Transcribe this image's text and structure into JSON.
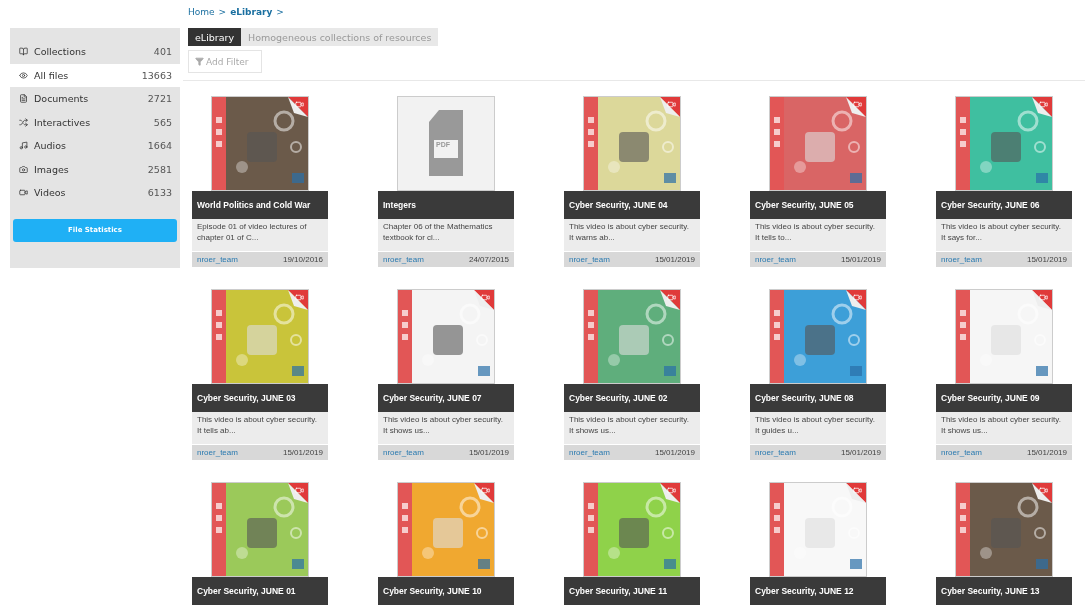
{
  "breadcrumb": [
    {
      "label": "Home",
      "current": false,
      "separator": ">"
    },
    {
      "label": "eLibrary",
      "current": true,
      "separator": ">"
    }
  ],
  "sidebar": {
    "items": [
      {
        "kind": "collections",
        "label": "Collections",
        "count": "401",
        "selected": false
      },
      {
        "kind": "all",
        "label": "All files",
        "count": "13663",
        "selected": true
      },
      {
        "kind": "documents",
        "label": "Documents",
        "count": "2721",
        "selected": false
      },
      {
        "kind": "interactives",
        "label": "Interactives",
        "count": "565",
        "selected": false
      },
      {
        "kind": "audios",
        "label": "Audios",
        "count": "1664",
        "selected": false
      },
      {
        "kind": "images",
        "label": "Images",
        "count": "2581",
        "selected": false
      },
      {
        "kind": "videos",
        "label": "Videos",
        "count": "6133",
        "selected": false
      }
    ],
    "button": "File Statistics"
  },
  "header": {
    "title": "eLibrary",
    "subtitle": "Homogeneous collections of resources",
    "filter_button": "Add Filter"
  },
  "cards": [
    {
      "kind": "video",
      "title": "World Politics and Cold War",
      "description": "Episode 01 of video lectures of chapter 01 of C...",
      "author": "nroer_team",
      "date": "19/10/2016"
    },
    {
      "kind": "pdf",
      "thumb_label": "PDF",
      "title": "Integers",
      "description": "Chapter 06 of the Mathematics textbook for cl...",
      "author": "nroer_team",
      "date": "24/07/2015"
    },
    {
      "kind": "video",
      "title": "Cyber Security, JUNE 04",
      "description": "This video is about cyber security. It warns ab...",
      "author": "nroer_team",
      "date": "15/01/2019"
    },
    {
      "kind": "video",
      "title": "Cyber Security, JUNE 05",
      "description": "This video is about cyber security. It tells to...",
      "author": "nroer_team",
      "date": "15/01/2019"
    },
    {
      "kind": "video",
      "title": "Cyber Security, JUNE 06",
      "description": "This video is about cyber security. It says for...",
      "author": "nroer_team",
      "date": "15/01/2019"
    },
    {
      "kind": "video",
      "title": "Cyber Security, JUNE 03",
      "description": "This video is about cyber security. It tells ab...",
      "author": "nroer_team",
      "date": "15/01/2019"
    },
    {
      "kind": "video",
      "title": "Cyber Security, JUNE 07",
      "description": "This video is about cyber security. It shows us...",
      "author": "nroer_team",
      "date": "15/01/2019"
    },
    {
      "kind": "video",
      "title": "Cyber Security, JUNE 02",
      "description": "This video is about cyber security. It shows us...",
      "author": "nroer_team",
      "date": "15/01/2019"
    },
    {
      "kind": "video",
      "title": "Cyber Security, JUNE 08",
      "description": "This video is about cyber security. It guides u...",
      "author": "nroer_team",
      "date": "15/01/2019"
    },
    {
      "kind": "video",
      "title": "Cyber Security, JUNE 09",
      "description": "This video is about cyber security. It shows us...",
      "author": "nroer_team",
      "date": "15/01/2019"
    },
    {
      "kind": "video",
      "title": "Cyber Security, JUNE 01"
    },
    {
      "kind": "video",
      "title": "Cyber Security, JUNE 10"
    },
    {
      "kind": "video",
      "title": "Cyber Security, JUNE 11"
    },
    {
      "kind": "video",
      "title": "Cyber Security, JUNE 12"
    },
    {
      "kind": "video",
      "title": "Cyber Security, JUNE 13"
    }
  ]
}
